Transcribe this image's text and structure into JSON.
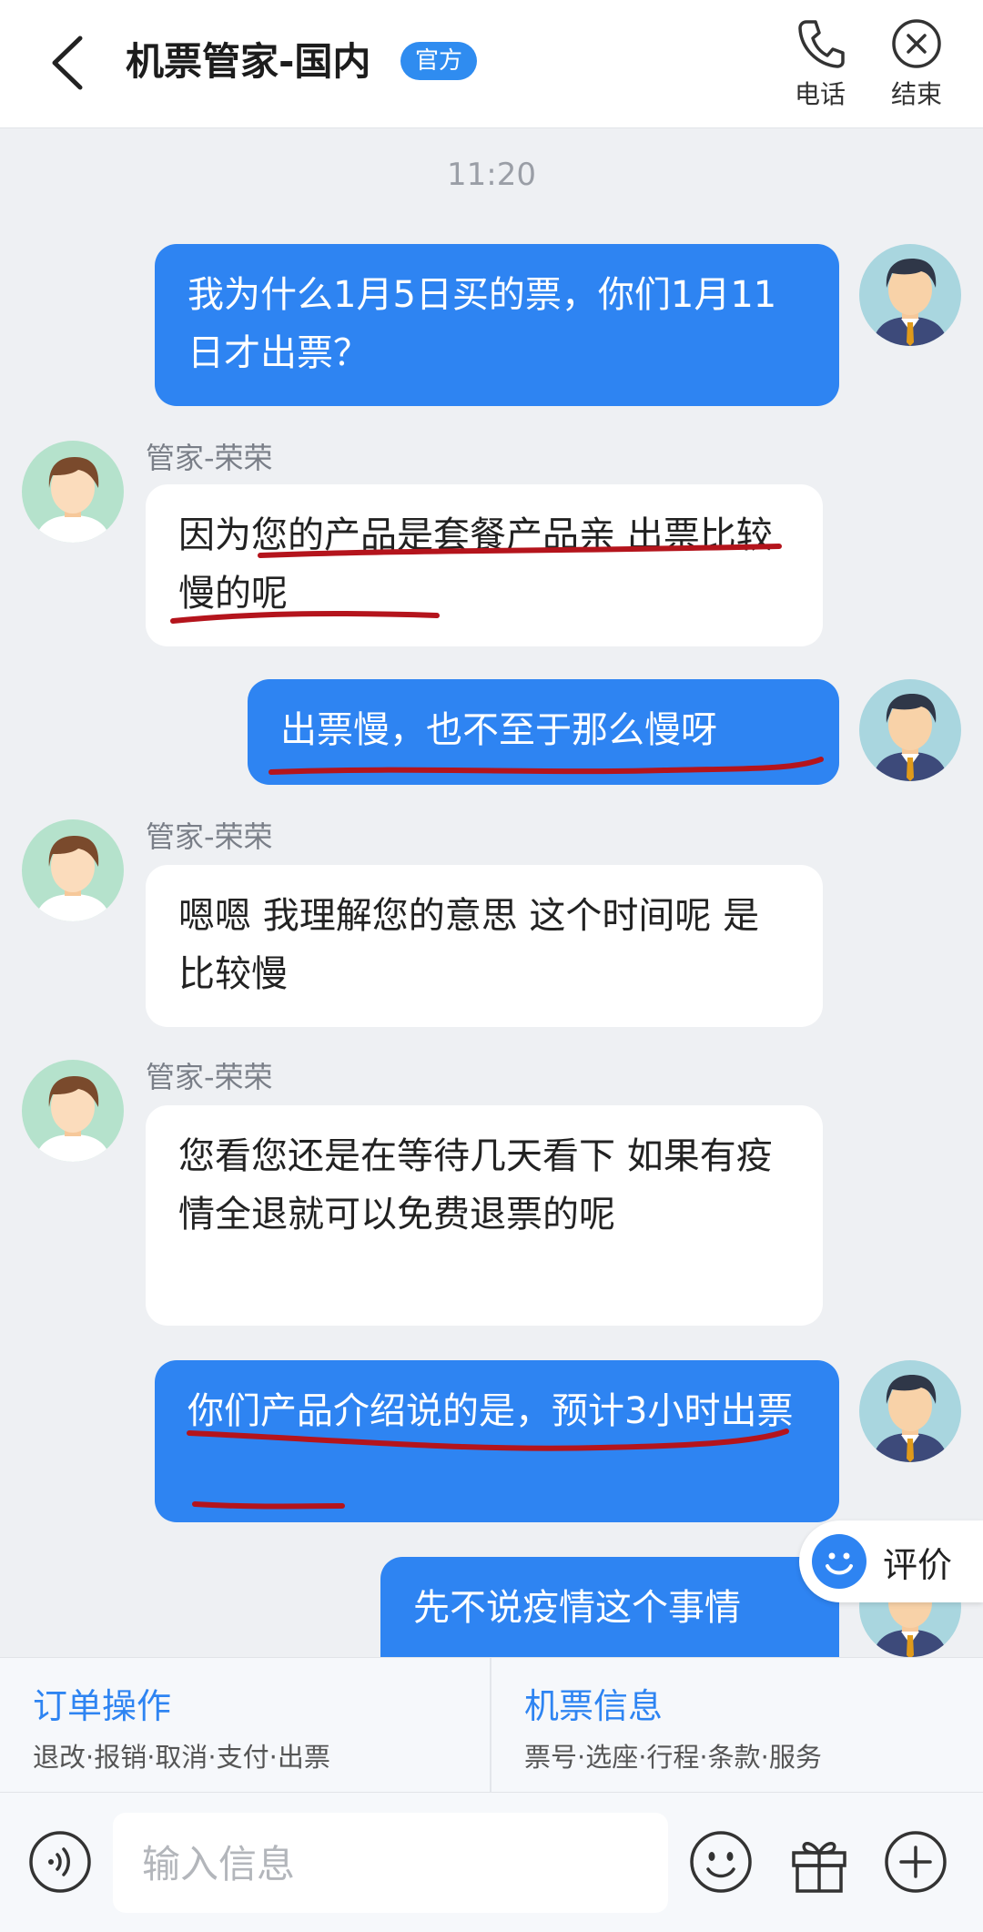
{
  "header": {
    "title": "机票管家-国内",
    "badge": "官方",
    "phone_label": "电话",
    "end_label": "结束"
  },
  "chat": {
    "timestamp": "11:20",
    "messages": [
      {
        "side": "out",
        "text": "我为什么1月5日买的票，你们1月11日才出票？"
      },
      {
        "side": "in",
        "sender": "管家-荣荣",
        "text": "因为您的产品是套餐产品亲 出票比较慢的呢"
      },
      {
        "side": "out",
        "text": "出票慢，也不至于那么慢呀"
      },
      {
        "side": "in",
        "sender": "管家-荣荣",
        "text": "嗯嗯 我理解您的意思 这个时间呢 是比较慢"
      },
      {
        "side": "in",
        "sender": "管家-荣荣",
        "text": "您看您还是在等待几天看下  如果有疫情全退就可以免费退票的呢"
      },
      {
        "side": "out",
        "text": "你们产品介绍说的是，预计3小时出票"
      },
      {
        "side": "out",
        "text": "先不说疫情这个事情"
      }
    ]
  },
  "rate": {
    "label": "评价"
  },
  "actions": [
    {
      "title": "订单操作",
      "subtitle": "退改·报销·取消·支付·出票"
    },
    {
      "title": "机票信息",
      "subtitle": "票号·选座·行程·条款·服务"
    }
  ],
  "input": {
    "placeholder": "输入信息"
  },
  "colors": {
    "accent": "#2e84f2",
    "badge": "#2f8cf0",
    "underline": "#b4141c"
  },
  "icons": [
    "back-icon",
    "phone-icon",
    "close-circle-icon",
    "voice-icon",
    "emoji-icon",
    "gift-icon",
    "plus-icon",
    "smile-icon"
  ]
}
